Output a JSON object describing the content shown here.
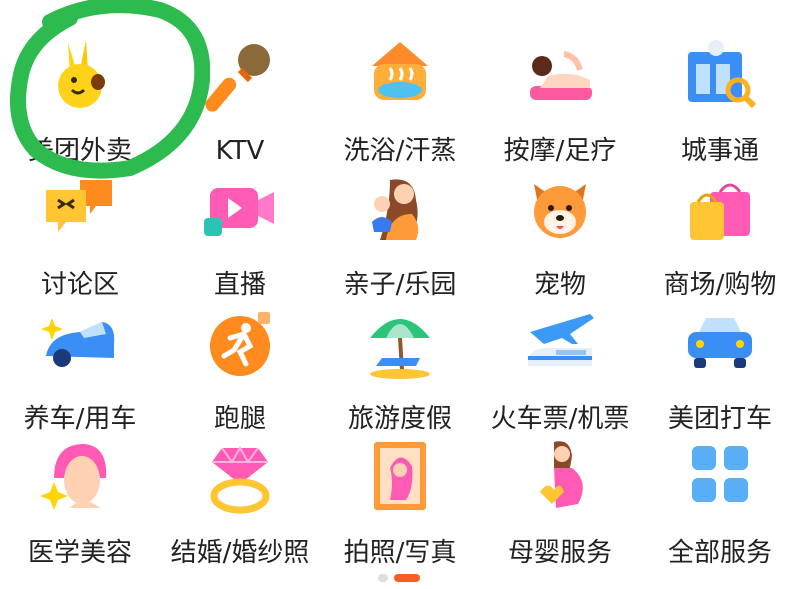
{
  "grid": {
    "rows": [
      [
        {
          "label": "美团外卖",
          "icon": "meituan-waimai-kangaroo-icon"
        },
        {
          "label": "KTV",
          "icon": "microphone-icon"
        },
        {
          "label": "洗浴/汗蒸",
          "icon": "hot-spring-icon"
        },
        {
          "label": "按摩/足疗",
          "icon": "massage-icon"
        },
        {
          "label": "城事通",
          "icon": "city-building-search-icon"
        }
      ],
      [
        {
          "label": "讨论区",
          "icon": "chat-bubbles-icon"
        },
        {
          "label": "直播",
          "icon": "live-video-icon"
        },
        {
          "label": "亲子/乐园",
          "icon": "mother-child-icon"
        },
        {
          "label": "宠物",
          "icon": "shiba-dog-icon"
        },
        {
          "label": "商场/购物",
          "icon": "shopping-bags-icon"
        }
      ],
      [
        {
          "label": "养车/用车",
          "icon": "car-sparkle-icon"
        },
        {
          "label": "跑腿",
          "icon": "running-courier-icon"
        },
        {
          "label": "旅游度假",
          "icon": "beach-umbrella-icon"
        },
        {
          "label": "火车票/机票",
          "icon": "train-plane-icon"
        },
        {
          "label": "美团打车",
          "icon": "taxi-car-icon"
        }
      ],
      [
        {
          "label": "医学美容",
          "icon": "beauty-face-icon"
        },
        {
          "label": "结婚/婚纱照",
          "icon": "diamond-ring-icon"
        },
        {
          "label": "拍照/写真",
          "icon": "photo-frame-icon"
        },
        {
          "label": "母婴服务",
          "icon": "pregnant-woman-icon"
        },
        {
          "label": "全部服务",
          "icon": "all-services-grid-icon"
        }
      ]
    ]
  },
  "pagination": {
    "pages": 2,
    "current": 2
  },
  "colors": {
    "accent": "#ff5a28",
    "circle": "#2dbb4f",
    "text": "#222222"
  }
}
